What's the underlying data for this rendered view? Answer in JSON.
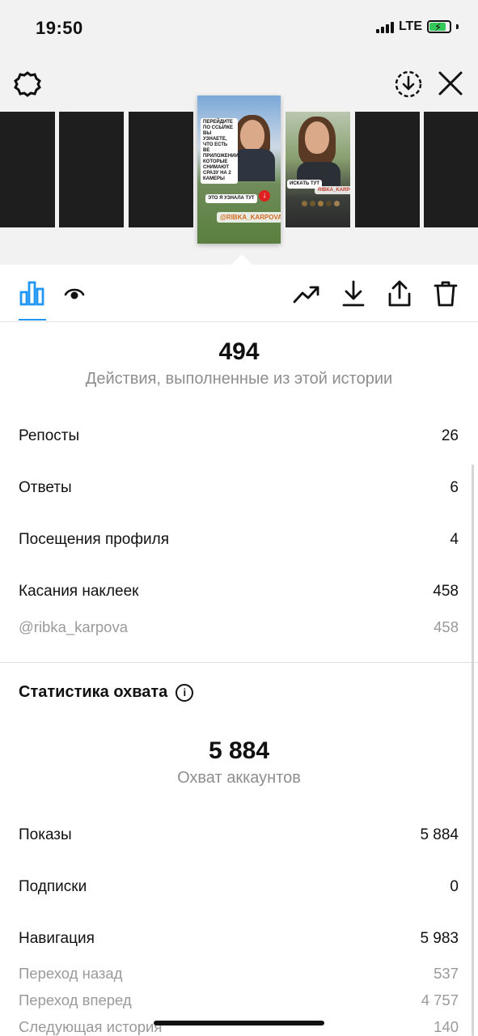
{
  "status_bar": {
    "time": "19:50",
    "network": "LTE"
  },
  "header": {
    "left_icon": "settings-icon",
    "right_icons": [
      "download-circle-icon",
      "close-icon"
    ]
  },
  "story_strip": {
    "active_thumb": {
      "sticker_text": "ПЕРЕЙДИТЕ ПО ССЫЛКЕ ВЫ УЗНАЕТЕ, ЧТО ЕСТЬ ВЕ ПРИЛОЖЕНИИ, КОТОРЫЕ СНИМАЮТ СРАЗУ НА 2 КАМЕРЫ",
      "sticker_label": "ЭТО Я УЗНАЛА ТУТ",
      "mention": "@RIBKA_KARPOVA"
    },
    "second_thumb": {
      "sticker_label": "ИСКАТЬ ТУТ",
      "mention": "RIBKA_KARPOVA"
    }
  },
  "tabs": {
    "items": [
      "insights-icon",
      "eye-icon"
    ],
    "actions": [
      "trending-icon",
      "download-icon",
      "share-icon",
      "trash-icon"
    ]
  },
  "interactions": {
    "total": "494",
    "subtitle": "Действия, выполненные из этой истории",
    "rows": [
      {
        "label": "Репосты",
        "value": "26"
      },
      {
        "label": "Ответы",
        "value": "6"
      },
      {
        "label": "Посещения профиля",
        "value": "4"
      },
      {
        "label": "Касания наклеек",
        "value": "458"
      }
    ],
    "sub_rows": [
      {
        "label": "@ribka_karpova",
        "value": "458"
      }
    ]
  },
  "reach": {
    "section_title": "Статистика охвата",
    "total": "5 884",
    "subtitle": "Охват аккаунтов",
    "rows": [
      {
        "label": "Показы",
        "value": "5 884"
      },
      {
        "label": "Подписки",
        "value": "0"
      },
      {
        "label": "Навигация",
        "value": "5 983"
      }
    ],
    "sub_rows": [
      {
        "label": "Переход назад",
        "value": "537"
      },
      {
        "label": "Переход вперед",
        "value": "4 757"
      },
      {
        "label": "Следующая история",
        "value": "140"
      }
    ]
  },
  "colors": {
    "accent": "#2196f3",
    "battery": "#34c759",
    "muted": "#8e8e8e"
  }
}
